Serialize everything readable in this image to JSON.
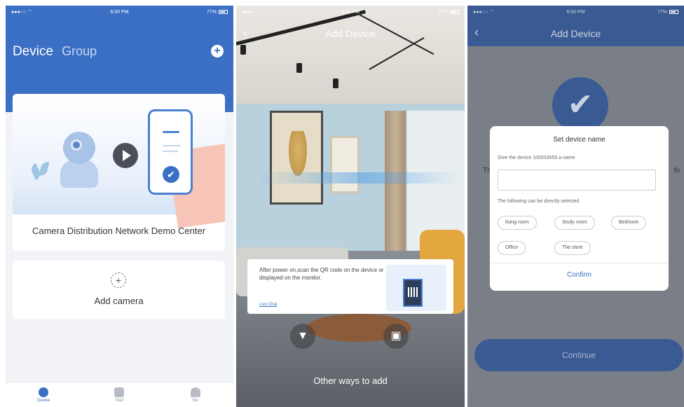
{
  "screen1": {
    "status": {
      "carrier": "●●●○○ ⌔",
      "time": "6:00 PM",
      "battery": "77%"
    },
    "tabs": {
      "device": "Device",
      "group": "Group"
    },
    "add_symbol": "+",
    "banner_title": "Camera Distribution Network Demo Center",
    "add_card": {
      "icon": "+",
      "label": "Add camera"
    },
    "tabbar": [
      {
        "label": "Device",
        "icon": "device-icon"
      },
      {
        "label": "Mall",
        "icon": "mall-icon"
      },
      {
        "label": "Me",
        "icon": "me-icon"
      }
    ],
    "colors": {
      "primary": "#3a6fc4",
      "background": "#f1f3f7"
    }
  },
  "screen2": {
    "status": {
      "carrier": "●●●○○ ⌔",
      "time": "6:00 PM",
      "battery": "77%"
    },
    "back": "‹",
    "title": "Add Device",
    "tip": {
      "text": "After power on,scan the QR code on the device or displayed on the monitor.",
      "link": "Live Chat"
    },
    "icons": {
      "left": "flashlight-icon",
      "right": "gallery-icon"
    },
    "other_ways": "Other ways to add"
  },
  "screen3": {
    "status": {
      "carrier": "●●●○○ ⌔",
      "time": "6:00 PM",
      "battery": "77%"
    },
    "back": "‹",
    "title": "Add Device",
    "check": "✔",
    "bg_left": "Th",
    "bg_right": "fo",
    "dialog": {
      "title": "Set device name",
      "subtitle": "Give the device 100033655 a name",
      "input_value": "",
      "hint": "The following can be directly selected",
      "chips": [
        "living room",
        "Study room",
        "Bedroom",
        "Office",
        "The store"
      ],
      "confirm": "Confirm"
    },
    "continue": "Continue"
  }
}
